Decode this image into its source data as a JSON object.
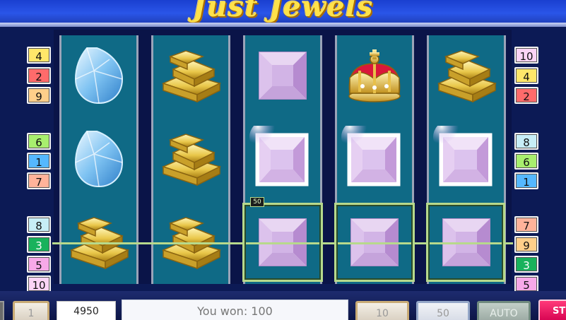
{
  "title": "Just Jewels",
  "colors": {
    "reel_bg": "#0f6a86",
    "payline": "#b7d98c",
    "header": "#2a55e8",
    "title": "#ffe24a"
  },
  "left_badges": [
    {
      "value": "4",
      "color": "#ffe76a"
    },
    {
      "value": "2",
      "color": "#ff6b6b"
    },
    {
      "value": "9",
      "color": "#ffcf8a"
    },
    {
      "value": "6",
      "color": "#a8ef6e"
    },
    {
      "value": "1",
      "color": "#55b8ff"
    },
    {
      "value": "7",
      "color": "#ffb39a"
    },
    {
      "value": "8",
      "color": "#c7eef7"
    },
    {
      "value": "3",
      "color": "#19b25c"
    },
    {
      "value": "5",
      "color": "#f7a9e8"
    },
    {
      "value": "10",
      "color": "#fbd4f6"
    }
  ],
  "right_badges": [
    {
      "value": "10",
      "color": "#fbd4f6"
    },
    {
      "value": "4",
      "color": "#ffe76a"
    },
    {
      "value": "2",
      "color": "#ff6b6b"
    },
    {
      "value": "8",
      "color": "#c7eef7"
    },
    {
      "value": "6",
      "color": "#a8ef6e"
    },
    {
      "value": "1",
      "color": "#55b8ff"
    },
    {
      "value": "7",
      "color": "#ffb39a"
    },
    {
      "value": "9",
      "color": "#ffcf8a"
    },
    {
      "value": "3",
      "color": "#19b25c"
    },
    {
      "value": "5",
      "color": "#f7a9e8"
    }
  ],
  "reels": [
    [
      "drop-diamond-icon",
      "drop-diamond-icon",
      "gold-bars-icon"
    ],
    [
      "gold-bars-icon",
      "gold-bars-icon",
      "gold-bars-icon"
    ],
    [
      "amethyst-icon",
      "amethyst-glowing-icon",
      "amethyst-icon"
    ],
    [
      "crown-icon",
      "amethyst-glowing-icon",
      "amethyst-icon"
    ],
    [
      "gold-bars-icon",
      "amethyst-glowing-icon",
      "amethyst-icon"
    ]
  ],
  "win": {
    "tag": "50",
    "line": "3"
  },
  "bottom": {
    "lines_value": "1",
    "credit": "4950",
    "message": "You won: 100",
    "bet_value": "10",
    "total_bet": "50",
    "auto_label": "AUTO",
    "start_label": "STO"
  }
}
